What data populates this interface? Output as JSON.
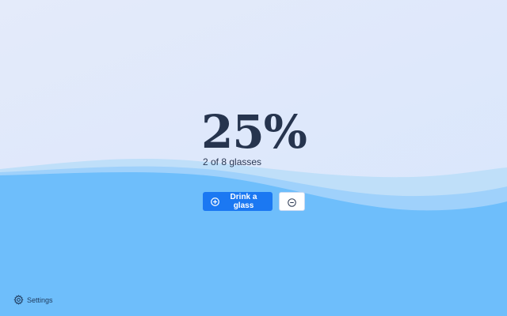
{
  "progress": {
    "percent_label": "25%",
    "fraction": 0.25,
    "summary": "2 of 8 glasses"
  },
  "actions": {
    "drink_label": "Drink a glass",
    "drink_icon": "plus-circle-icon",
    "undo_icon": "minus-circle-icon"
  },
  "footer": {
    "settings_label": "Settings",
    "settings_icon": "gear-icon"
  },
  "colors": {
    "primary": "#1b78f2",
    "water_light": "#a9d7fb",
    "water": "#6ebdfb",
    "text": "#26344e"
  }
}
